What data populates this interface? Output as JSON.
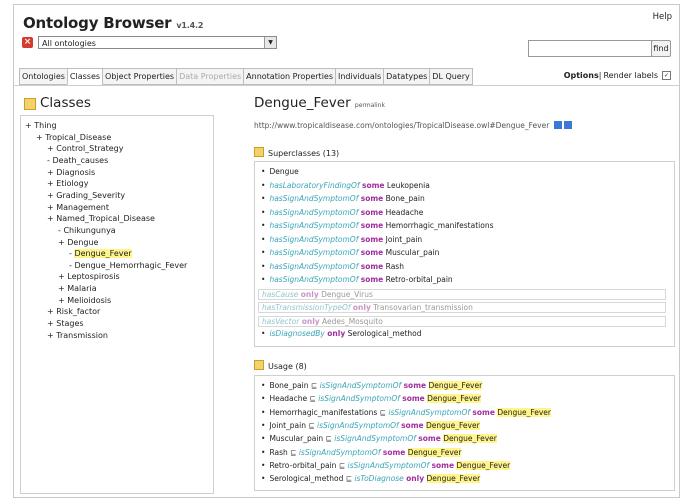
{
  "app": {
    "title": "Ontology Browser",
    "version": "v1.4.2",
    "help": "Help",
    "ontology_select": "All ontologies",
    "find_label": "find",
    "search_value": ""
  },
  "tabs": [
    {
      "label": "Ontologies",
      "state": "normal"
    },
    {
      "label": "Classes",
      "state": "active"
    },
    {
      "label": "Object Properties",
      "state": "normal"
    },
    {
      "label": "Data Properties",
      "state": "disabled"
    },
    {
      "label": "Annotation Properties",
      "state": "normal"
    },
    {
      "label": "Individuals",
      "state": "normal"
    },
    {
      "label": "Datatypes",
      "state": "normal"
    },
    {
      "label": "DL Query",
      "state": "normal"
    }
  ],
  "options": {
    "options_label": "Options",
    "separator": "|",
    "render_labels": "Render labels",
    "render_checked": "✓"
  },
  "classes_panel": {
    "title": "Classes",
    "tree": [
      {
        "label": "Thing",
        "prefix": "+",
        "depth": 0
      },
      {
        "label": "Tropical_Disease",
        "prefix": "+",
        "depth": 1
      },
      {
        "label": "Control_Strategy",
        "prefix": "+",
        "depth": 2
      },
      {
        "label": "Death_causes",
        "prefix": "-",
        "depth": 2
      },
      {
        "label": "Diagnosis",
        "prefix": "+",
        "depth": 2
      },
      {
        "label": "Etiology",
        "prefix": "+",
        "depth": 2
      },
      {
        "label": "Grading_Severity",
        "prefix": "+",
        "depth": 2
      },
      {
        "label": "Management",
        "prefix": "+",
        "depth": 2
      },
      {
        "label": "Named_Tropical_Disease",
        "prefix": "+",
        "depth": 2
      },
      {
        "label": "Chikungunya",
        "prefix": "-",
        "depth": 3
      },
      {
        "label": "Dengue",
        "prefix": "+",
        "depth": 3
      },
      {
        "label": "Dengue_Fever",
        "prefix": "-",
        "depth": 4,
        "selected": true
      },
      {
        "label": "Dengue_Hemorrhagic_Fever",
        "prefix": "-",
        "depth": 4
      },
      {
        "label": "Leptospirosis",
        "prefix": "+",
        "depth": 3
      },
      {
        "label": "Malaria",
        "prefix": "+",
        "depth": 3
      },
      {
        "label": "Melioidosis",
        "prefix": "+",
        "depth": 3
      },
      {
        "label": "Risk_factor",
        "prefix": "+",
        "depth": 2
      },
      {
        "label": "Stages",
        "prefix": "+",
        "depth": 2
      },
      {
        "label": "Transmission",
        "prefix": "+",
        "depth": 2
      }
    ]
  },
  "entity": {
    "name": "Dengue_Fever",
    "permalink": "permalink",
    "iri": "http://www.tropicaldisease.com/ontologies/TropicalDisease.owl#Dengue_Fever"
  },
  "superclasses": {
    "header": "Superclasses (13)",
    "items": [
      {
        "prop": "",
        "kw": "",
        "target": "Dengue",
        "faded": false
      },
      {
        "prop": "hasLaboratoryFindingOf",
        "kw": "some",
        "target": "Leukopenia",
        "faded": false
      },
      {
        "prop": "hasSignAndSymptomOf",
        "kw": "some",
        "target": "Bone_pain",
        "faded": false
      },
      {
        "prop": "hasSignAndSymptomOf",
        "kw": "some",
        "target": "Headache",
        "faded": false
      },
      {
        "prop": "hasSignAndSymptomOf",
        "kw": "some",
        "target": "Hemorrhagic_manifestations",
        "faded": false
      },
      {
        "prop": "hasSignAndSymptomOf",
        "kw": "some",
        "target": "Joint_pain",
        "faded": false
      },
      {
        "prop": "hasSignAndSymptomOf",
        "kw": "some",
        "target": "Muscular_pain",
        "faded": false
      },
      {
        "prop": "hasSignAndSymptomOf",
        "kw": "some",
        "target": "Rash",
        "faded": false
      },
      {
        "prop": "hasSignAndSymptomOf",
        "kw": "some",
        "target": "Retro-orbital_pain",
        "faded": false
      },
      {
        "prop": "hasCause",
        "kw": "only",
        "target": "Dengue_Virus",
        "faded": true
      },
      {
        "prop": "hasTransmissionTypeOf",
        "kw": "only",
        "target": "Transovarian_transmission",
        "faded": true
      },
      {
        "prop": "hasVector",
        "kw": "only",
        "target": "Aedes_Mosquito",
        "faded": true
      },
      {
        "prop": "isDiagnosedBy",
        "kw": "only",
        "target": "Serological_method",
        "faded": false
      }
    ]
  },
  "usage": {
    "header": "Usage (8)",
    "subclass_symbol": "⊑",
    "items": [
      {
        "subject": "Bone_pain",
        "prop": "isSignAndSymptomOf",
        "kw": "some",
        "target": "Dengue_Fever"
      },
      {
        "subject": "Headache",
        "prop": "isSignAndSymptomOf",
        "kw": "some",
        "target": "Dengue_Fever"
      },
      {
        "subject": "Hemorrhagic_manifestations",
        "prop": "isSignAndSymptomOf",
        "kw": "some",
        "target": "Dengue_Fever"
      },
      {
        "subject": "Joint_pain",
        "prop": "isSignAndSymptomOf",
        "kw": "some",
        "target": "Dengue_Fever"
      },
      {
        "subject": "Muscular_pain",
        "prop": "isSignAndSymptomOf",
        "kw": "some",
        "target": "Dengue_Fever"
      },
      {
        "subject": "Rash",
        "prop": "isSignAndSymptomOf",
        "kw": "some",
        "target": "Dengue_Fever"
      },
      {
        "subject": "Retro-orbital_pain",
        "prop": "isSignAndSymptomOf",
        "kw": "some",
        "target": "Dengue_Fever"
      },
      {
        "subject": "Serological_method",
        "prop": "isToDiagnose",
        "kw": "only",
        "target": "Dengue_Fever"
      }
    ]
  }
}
